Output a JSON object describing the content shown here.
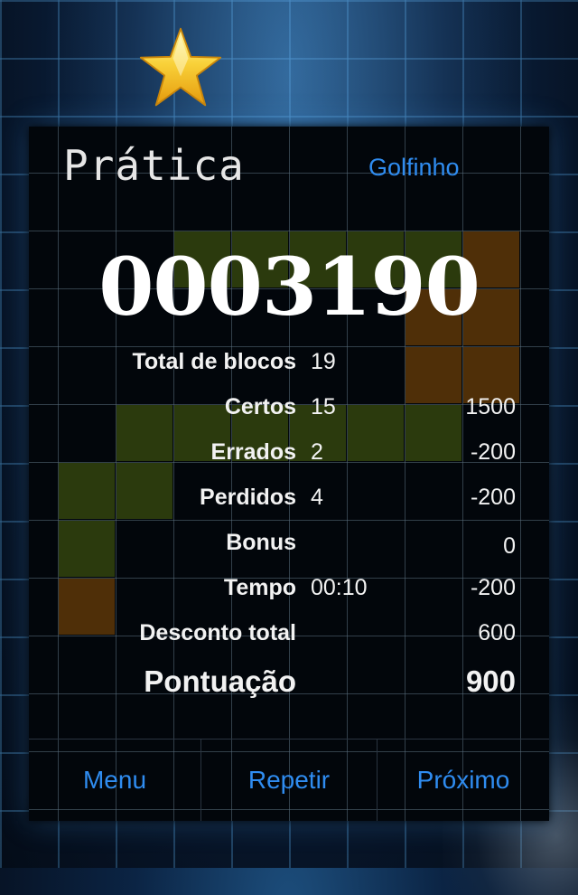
{
  "header": {
    "title": "Prática",
    "level_name": "Golfinho"
  },
  "score": {
    "display": "0003190"
  },
  "stats": [
    {
      "label": "Total de blocos",
      "count": "19",
      "points": ""
    },
    {
      "label": "Certos",
      "count": "15",
      "points": "1500"
    },
    {
      "label": "Errados",
      "count": "2",
      "points": "-200"
    },
    {
      "label": "Perdidos",
      "count": "4",
      "points": "-200"
    },
    {
      "label": "Bonus",
      "count": "",
      "points": "0"
    },
    {
      "label": "Tempo",
      "count": "00:10",
      "points": "-200"
    },
    {
      "label": "Desconto total",
      "count": "",
      "points": "600"
    }
  ],
  "total": {
    "label": "Pontuação",
    "points": "900"
  },
  "footer": {
    "menu_label": "Menu",
    "repeat_label": "Repetir",
    "next_label": "Próximo"
  },
  "icons": {
    "star": "star-icon"
  },
  "colors": {
    "accent": "#2f8cf0",
    "star": "#f6c21c",
    "block_green": "#2b3a0d",
    "block_orange": "#4f2f08"
  }
}
